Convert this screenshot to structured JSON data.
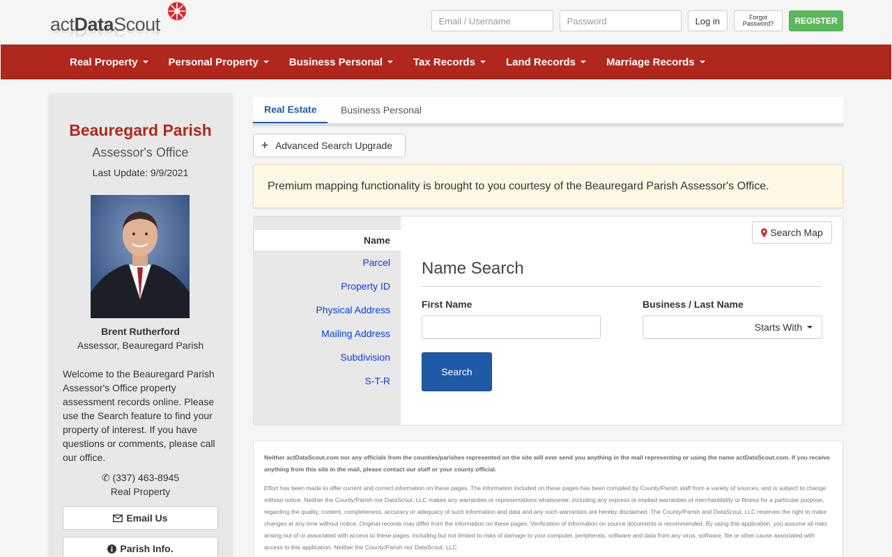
{
  "header": {
    "logo_text_light": "act",
    "logo_text_bold": "Data",
    "logo_text_end": "Scout",
    "email_placeholder": "Email / Username",
    "password_placeholder": "Password",
    "login_label": "Log in",
    "forgot_line1": "Forgot",
    "forgot_line2": "Password?",
    "register_label": "REGISTER"
  },
  "nav": {
    "items": [
      {
        "label": "Real Property"
      },
      {
        "label": "Personal Property"
      },
      {
        "label": "Business Personal"
      },
      {
        "label": "Tax Records"
      },
      {
        "label": "Land Records"
      },
      {
        "label": "Marriage Records"
      }
    ]
  },
  "sidebar": {
    "parish_name": "Beauregard Parish",
    "office_name": "Assessor's Office",
    "last_update": "Last Update: 9/9/2021",
    "assessor_name": "Brent Rutherford",
    "assessor_title": "Assessor, Beauregard Parish",
    "welcome": "Welcome to the Beauregard Parish Assessor's Office property assessment records online. Please use the Search feature to find your property of interest. If you have questions or comments, please call our office.",
    "phone": "(337) 463-8945",
    "phone_sub": "Real Property",
    "email_button": "Email Us",
    "info_button": "Parish Info."
  },
  "tabs": {
    "active": "Real Estate",
    "inactive": "Business Personal"
  },
  "advanced_search_label": "Advanced Search Upgrade",
  "alert_text": "Premium mapping functionality is brought to you courtesy of the Beauregard Parish Assessor's Office.",
  "search": {
    "menu": [
      "Name",
      "Parcel",
      "Property ID",
      "Physical Address",
      "Mailing Address",
      "Subdivision",
      "S-T-R"
    ],
    "map_button": "Search Map",
    "heading": "Name Search",
    "first_name_label": "First Name",
    "last_name_label": "Business / Last Name",
    "first_name_value": "",
    "last_name_value": "",
    "match_mode": "Starts With",
    "search_button": "Search"
  },
  "disclaimer": {
    "bold": "Neither actDataScout.com nor any officials from the counties/parishes represented on the site will ever send you anything in the mail representing or using the name actDataScout.com. If you receive anything from this site in the mail, please contact our staff or your county official.",
    "body": "Effort has been made to offer current and correct information on these pages. The information included on these pages has been compiled by County/Parish staff from a variety of sources, and is subject to change without notice. Neither the County/Parish nor DataScout, LLC makes any warranties or representations whatsoever, including any express or implied warranties of merchantibility or fitness for a particular purpose, regarding the quality, content, completeness, accuracy or adequacy of such information and data and any such warranties are hereby disclaimed. The County/Parish and DataScout, LLC reserves the right to make changes at any time without notice. Original records may differ from the information on these pages. Verification of information on source documents is recommended. By using this application, you assume all risks arising out of or associated with access to these pages, including but not limited to risks of damage to your computer, peripherals, software and data from any virus, software, file or other cause associated with access to this application. Neither the County/Parish nor DataScout, LLC"
  },
  "colors": {
    "brand_red": "#b0271d",
    "primary_blue": "#1f5aa6",
    "register_green": "#5cb85c",
    "alert_bg": "#fcf8e3"
  }
}
